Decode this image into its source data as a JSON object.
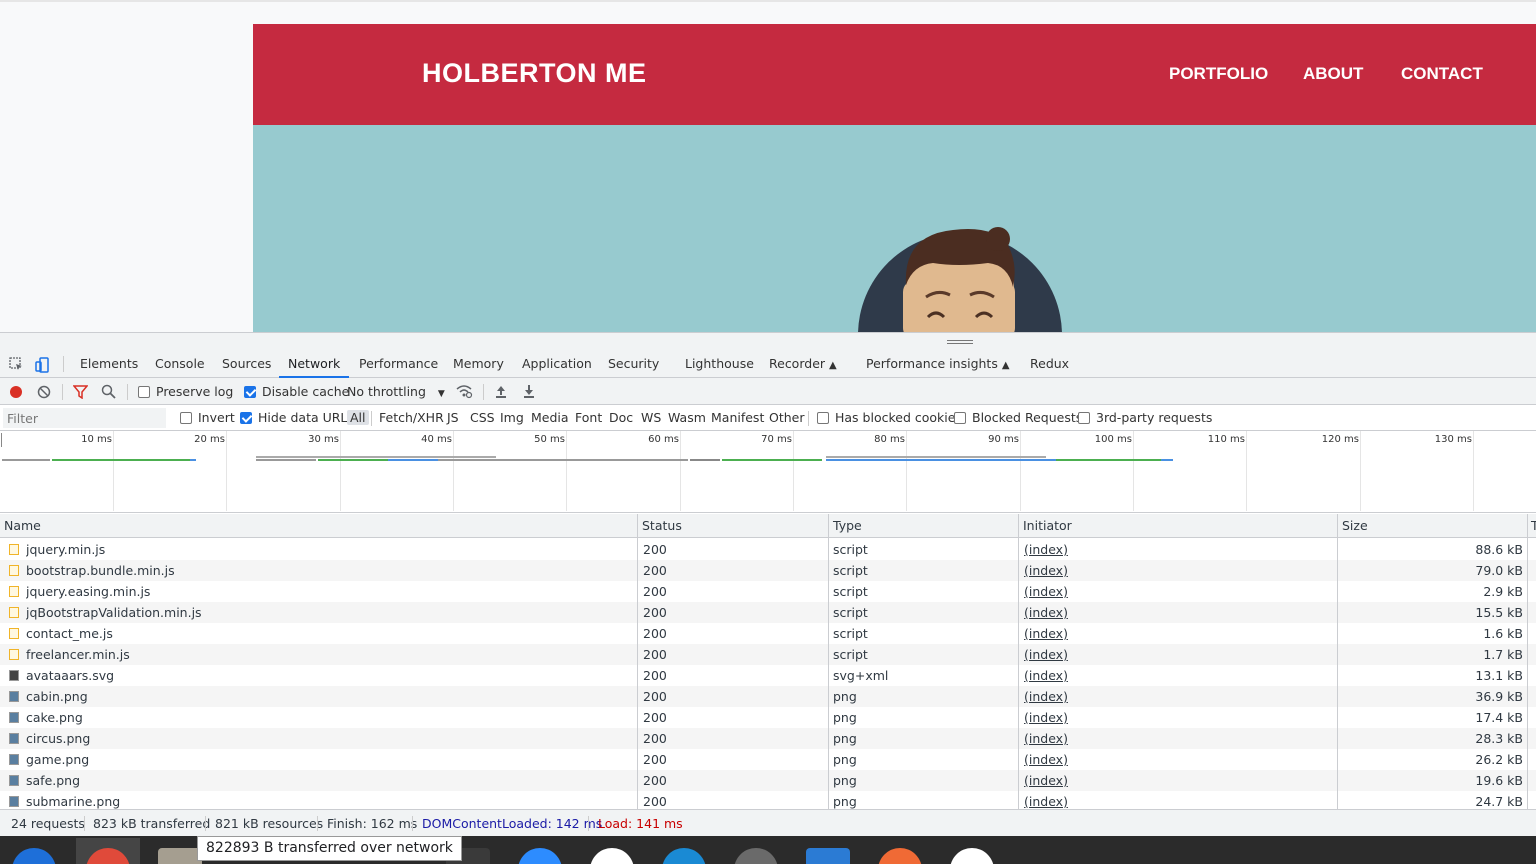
{
  "site": {
    "brand": "HOLBERTON ME",
    "nav_links": [
      "PORTFOLIO",
      "ABOUT",
      "CONTACT"
    ],
    "colors": {
      "navbar": "#c52a40",
      "hero": "#97cacf"
    }
  },
  "devtools": {
    "tabs": [
      "Elements",
      "Console",
      "Sources",
      "Network",
      "Performance",
      "Memory",
      "Application",
      "Security",
      "Lighthouse",
      "Recorder",
      "Performance insights",
      "Redux"
    ],
    "active_tab": "Network",
    "toolbar": {
      "preserve_log": "Preserve log",
      "disable_cache": "Disable cache",
      "throttling": "No throttling"
    },
    "filter": {
      "placeholder": "Filter",
      "invert": "Invert",
      "hide_data_urls": "Hide data URLs",
      "types": [
        "All",
        "Fetch/XHR",
        "JS",
        "CSS",
        "Img",
        "Media",
        "Font",
        "Doc",
        "WS",
        "Wasm",
        "Manifest",
        "Other"
      ],
      "has_blocked_cookies": "Has blocked cookies",
      "blocked_requests": "Blocked Requests",
      "third_party": "3rd-party requests"
    },
    "overview_ticks": [
      "10 ms",
      "20 ms",
      "30 ms",
      "40 ms",
      "50 ms",
      "60 ms",
      "70 ms",
      "80 ms",
      "90 ms",
      "100 ms",
      "110 ms",
      "120 ms",
      "130 ms"
    ],
    "table": {
      "columns": [
        "Name",
        "Status",
        "Type",
        "Initiator",
        "Size",
        "T"
      ],
      "rows": [
        {
          "name": "jquery.min.js",
          "status": "200",
          "type": "script",
          "initiator": "(index)",
          "size": "88.6 kB",
          "icon": "script-file-icon"
        },
        {
          "name": "bootstrap.bundle.min.js",
          "status": "200",
          "type": "script",
          "initiator": "(index)",
          "size": "79.0 kB",
          "icon": "script-file-icon"
        },
        {
          "name": "jquery.easing.min.js",
          "status": "200",
          "type": "script",
          "initiator": "(index)",
          "size": "2.9 kB",
          "icon": "script-file-icon"
        },
        {
          "name": "jqBootstrapValidation.min.js",
          "status": "200",
          "type": "script",
          "initiator": "(index)",
          "size": "15.5 kB",
          "icon": "script-file-icon"
        },
        {
          "name": "contact_me.js",
          "status": "200",
          "type": "script",
          "initiator": "(index)",
          "size": "1.6 kB",
          "icon": "script-file-icon"
        },
        {
          "name": "freelancer.min.js",
          "status": "200",
          "type": "script",
          "initiator": "(index)",
          "size": "1.7 kB",
          "icon": "script-file-icon"
        },
        {
          "name": "avataaars.svg",
          "status": "200",
          "type": "svg+xml",
          "initiator": "(index)",
          "size": "13.1 kB",
          "icon": "svg-image-icon"
        },
        {
          "name": "cabin.png",
          "status": "200",
          "type": "png",
          "initiator": "(index)",
          "size": "36.9 kB",
          "icon": "png-image-icon"
        },
        {
          "name": "cake.png",
          "status": "200",
          "type": "png",
          "initiator": "(index)",
          "size": "17.4 kB",
          "icon": "png-image-icon"
        },
        {
          "name": "circus.png",
          "status": "200",
          "type": "png",
          "initiator": "(index)",
          "size": "28.3 kB",
          "icon": "png-image-icon"
        },
        {
          "name": "game.png",
          "status": "200",
          "type": "png",
          "initiator": "(index)",
          "size": "26.2 kB",
          "icon": "png-image-icon"
        },
        {
          "name": "safe.png",
          "status": "200",
          "type": "png",
          "initiator": "(index)",
          "size": "19.6 kB",
          "icon": "png-image-icon"
        },
        {
          "name": "submarine.png",
          "status": "200",
          "type": "png",
          "initiator": "(index)",
          "size": "24.7 kB",
          "icon": "png-image-icon"
        }
      ]
    },
    "status_bar": {
      "requests": "24 requests",
      "transferred": "823 kB transferred",
      "resources": "821 kB resources",
      "finish": "Finish: 162 ms",
      "dom_content_loaded": "DOMContentLoaded: 142 ms",
      "load": "Load: 141 ms",
      "colors": {
        "dcl": "#1a1aa6",
        "load": "#c80000"
      }
    },
    "tooltip": "822893 B transferred over network"
  }
}
